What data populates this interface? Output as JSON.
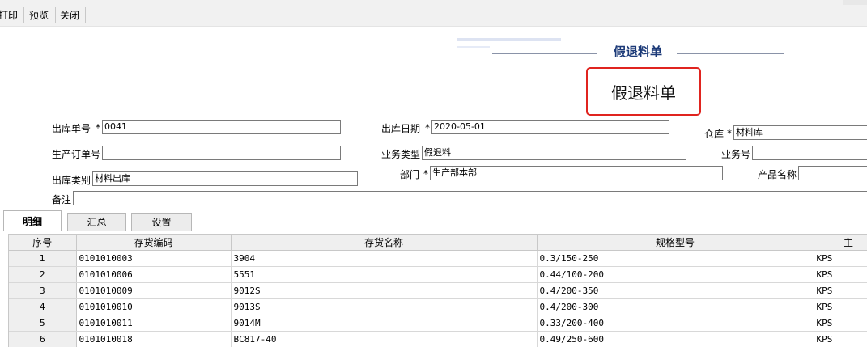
{
  "toolbar": {
    "print_label": "打印",
    "preview_label": "预览",
    "close_label": "关闭"
  },
  "document": {
    "title": "假退料单",
    "highlight_title": "假退料单"
  },
  "form": {
    "out_no": {
      "label": "出库单号",
      "value": "0041",
      "required": true
    },
    "out_date": {
      "label": "出库日期",
      "value": "2020-05-01",
      "required": true
    },
    "warehouse": {
      "label": "仓库",
      "value": "材料库",
      "required": true
    },
    "production_order": {
      "label": "生产订单号",
      "value": ""
    },
    "business_type": {
      "label": "业务类型",
      "value": "假退料"
    },
    "business_no": {
      "label": "业务号",
      "value": ""
    },
    "out_category": {
      "label": "出库类别",
      "value": "材料出库"
    },
    "department": {
      "label": "部门",
      "value": "生产部本部",
      "required": true
    },
    "product_name": {
      "label": "产品名称",
      "value": ""
    },
    "remark": {
      "label": "备注",
      "value": ""
    }
  },
  "tabs": [
    {
      "label": "明细",
      "active": true
    },
    {
      "label": "汇总",
      "active": false
    },
    {
      "label": "设置",
      "active": false
    }
  ],
  "table": {
    "columns": [
      "序号",
      "存货编码",
      "存货名称",
      "规格型号",
      "主"
    ],
    "rows": [
      {
        "seq": "1",
        "code": "0101010003",
        "name": "3904",
        "spec": "0.3/150-250",
        "unit": "KPS"
      },
      {
        "seq": "2",
        "code": "0101010006",
        "name": "5551",
        "spec": "0.44/100-200",
        "unit": "KPS"
      },
      {
        "seq": "3",
        "code": "0101010009",
        "name": "9012S",
        "spec": "0.4/200-350",
        "unit": "KPS"
      },
      {
        "seq": "4",
        "code": "0101010010",
        "name": "9013S",
        "spec": "0.4/200-300",
        "unit": "KPS"
      },
      {
        "seq": "5",
        "code": "0101010011",
        "name": "9014M",
        "spec": "0.33/200-400",
        "unit": "KPS"
      },
      {
        "seq": "6",
        "code": "0101010018",
        "name": "BC817-40",
        "spec": "0.49/250-600",
        "unit": "KPS"
      }
    ]
  },
  "colors": {
    "title_blue": "#1c3a78",
    "highlight_red": "#e0241f"
  }
}
